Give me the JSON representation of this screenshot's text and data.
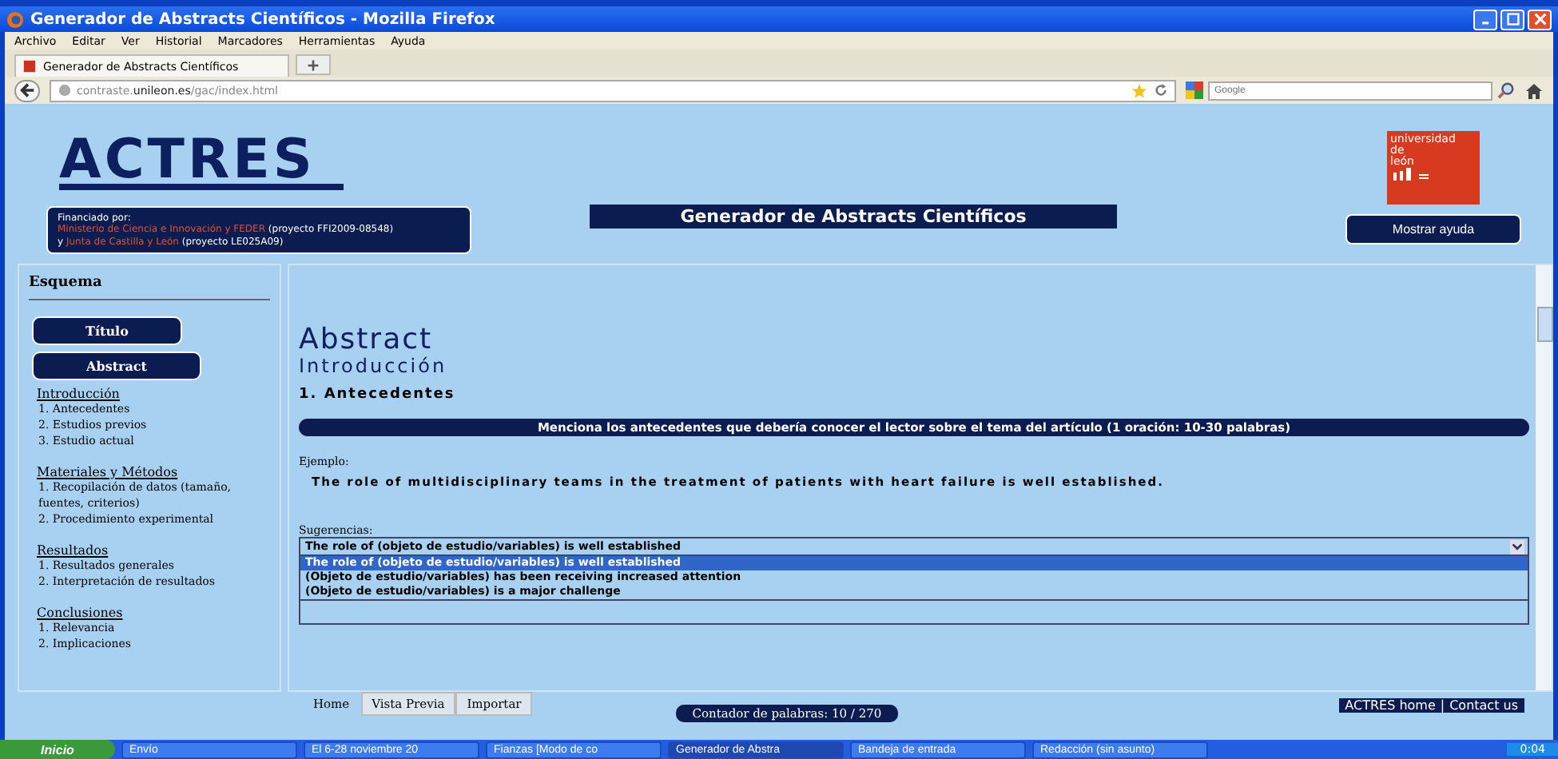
{
  "window": {
    "title": "Generador de Abstracts Científicos - Mozilla Firefox"
  },
  "menu": [
    "Archivo",
    "Editar",
    "Ver",
    "Historial",
    "Marcadores",
    "Herramientas",
    "Ayuda"
  ],
  "browser_tabs": [
    {
      "label": "Generador de Abstracts Científicos",
      "selected": true
    }
  ],
  "address": {
    "host_pre": "contraste.",
    "host": "unileon.es",
    "path": "/gac/index.html"
  },
  "search": {
    "placeholder": "Google"
  },
  "header": {
    "logo": "ACTRES",
    "funding": {
      "label": "Financiado por:",
      "line1_org": "Ministerio de Ciencia e Innovación y FEDER",
      "line1_ref": "(proyecto FFI2009-08548)",
      "line2_pre": "y",
      "line2_org": "Junta de Castilla y León",
      "line2_ref": "(proyecto LE025A09)"
    },
    "title": "Generador de Abstracts Científicos",
    "help_button": "Mostrar ayuda",
    "university": [
      "universidad",
      "de",
      "león"
    ]
  },
  "sidebar": {
    "title": "Esquema",
    "buttons": [
      "Título",
      "Abstract"
    ],
    "sections": [
      {
        "title": "Introducción",
        "items": [
          "1. Antecedentes",
          "2. Estudios previos",
          "3. Estudio actual"
        ]
      },
      {
        "title": "Materiales y Métodos",
        "items": [
          "1. Recopilación de datos (tamaño, fuentes, criterios)",
          "2. Procedimiento experimental"
        ]
      },
      {
        "title": "Resultados",
        "items": [
          "1. Resultados generales",
          "2. Interpretación de resultados"
        ]
      },
      {
        "title": "Conclusiones",
        "items": [
          "1. Relevancia",
          "2. Implicaciones"
        ]
      }
    ]
  },
  "main": {
    "heading": "Abstract",
    "section": "Introducción",
    "subsection": "1. Antecedentes",
    "instruction": "Menciona los antecedentes que debería conocer el lector sobre el tema del artículo (1 oración: 10-30 palabras)",
    "example_label": "Ejemplo:",
    "example": "The role of multidisciplinary teams in the treatment of patients with heart failure is well established.",
    "suggestions_label": "Sugerencias:",
    "suggestion_value": "The role of (objeto de estudio/variables) is well established",
    "options": [
      {
        "label": "The role of (objeto de estudio/variables) is well established",
        "selected": true
      },
      {
        "label": "(Objeto de estudio/variables) has been receiving increased attention",
        "selected": false
      },
      {
        "label": "(Objeto de estudio/variables) is a major challenge",
        "selected": false
      }
    ]
  },
  "bottom_tabs": [
    {
      "label": "Home",
      "selected": true
    },
    {
      "label": "Vista Previa",
      "selected": false
    },
    {
      "label": "Importar",
      "selected": false
    }
  ],
  "word_counter": "Contador de palabras: 10 / 270",
  "footer_links": [
    "ACTRES home",
    "Contact us"
  ],
  "footer_separator": "|",
  "taskbar": {
    "start": "Inicio",
    "items": [
      {
        "label": "Envío",
        "selected": false
      },
      {
        "label": "El 6-28 noviembre 20",
        "selected": false
      },
      {
        "label": "Fianzas [Modo de co",
        "selected": false
      },
      {
        "label": "Generador de Abstra",
        "selected": true
      },
      {
        "label": "Bandeja de entrada",
        "selected": false
      },
      {
        "label": "Redacción (sin asunto)",
        "selected": false
      }
    ],
    "clock": "0:04"
  }
}
